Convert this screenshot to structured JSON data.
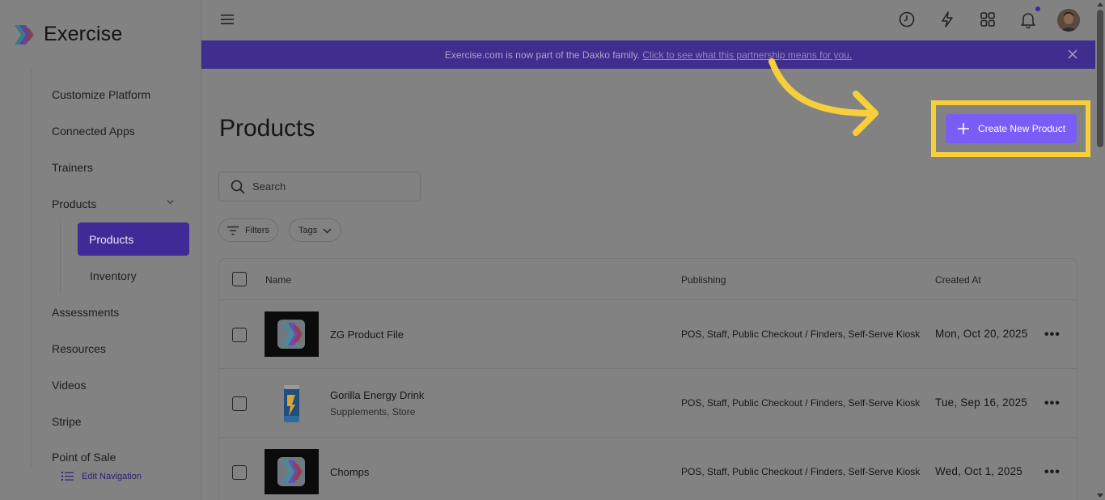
{
  "app": {
    "brand": "Exercise"
  },
  "sidebar": {
    "items": [
      {
        "label": "Customize Platform"
      },
      {
        "label": "Connected Apps"
      },
      {
        "label": "Trainers"
      },
      {
        "label": "Products"
      },
      {
        "label": "Products"
      },
      {
        "label": "Inventory"
      },
      {
        "label": "Assessments"
      },
      {
        "label": "Resources"
      },
      {
        "label": "Videos"
      },
      {
        "label": "Stripe"
      },
      {
        "label": "Point of Sale"
      }
    ],
    "active_item": "Products",
    "edit_navigation": "Edit Navigation"
  },
  "banner": {
    "text": "Exercise.com is now part of the Daxko family.",
    "link": "Click to see what this partnership means for you."
  },
  "main": {
    "title": "Products",
    "create_button": "Create New Product",
    "search_placeholder": "Search",
    "filters_label": "Filters",
    "tags_label": "Tags"
  },
  "table": {
    "columns": [
      "Name",
      "Publishing",
      "Created At"
    ],
    "rows": [
      {
        "name": "ZG Product File",
        "subtitle": "",
        "publishing": "POS, Staff, Public Checkout / Finders, Self-Serve Kiosk",
        "created": "Mon, Oct 20, 2025"
      },
      {
        "name": "Gorilla Energy Drink",
        "subtitle": "Supplements, Store",
        "publishing": "POS, Staff, Public Checkout / Finders, Self-Serve Kiosk",
        "created": "Tue, Sep 16, 2025"
      },
      {
        "name": "Chomps",
        "subtitle": "",
        "publishing": "POS, Staff, Public Checkout / Finders, Self-Serve Kiosk",
        "created": "Wed, Oct 1, 2025"
      }
    ]
  },
  "colors": {
    "accent": "#7b5cf6",
    "banner": "#3f2e8d",
    "highlight": "#f7cf3a",
    "overlay_bg": "#828282"
  }
}
